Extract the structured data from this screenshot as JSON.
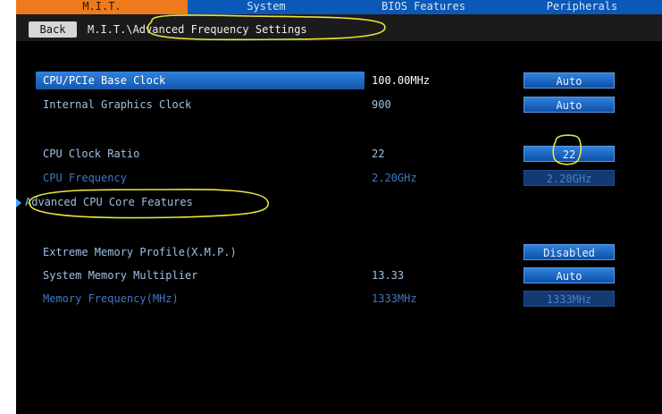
{
  "tabs": [
    "M.I.T.",
    "System",
    "BIOS Features",
    "Peripherals"
  ],
  "active_tab": "M.I.T.",
  "breadcrumb": {
    "back_label": "Back",
    "path": "M.I.T.\\Advanced Frequency Settings"
  },
  "rows": [
    {
      "label": "CPU/PCIe Base Clock",
      "value": "100.00MHz",
      "option": "Auto",
      "selected": true
    },
    {
      "label": "Internal Graphics Clock",
      "value": "900",
      "option": "Auto"
    },
    {
      "label": "CPU Clock Ratio",
      "value": "22",
      "option": "22"
    },
    {
      "label": "CPU Frequency",
      "value": "2.20GHz",
      "option": "2.20GHz",
      "disabled": true
    },
    {
      "label": "Advanced CPU Core Features",
      "submenu": true
    },
    {
      "label": "Extreme Memory Profile(X.M.P.)",
      "value": "",
      "option": "Disabled"
    },
    {
      "label": "System Memory Multiplier",
      "value": "13.33",
      "option": "Auto"
    },
    {
      "label": "Memory Frequency(MHz)",
      "value": "1333MHz",
      "option": "1333MHz",
      "disabled": true
    }
  ],
  "colors": {
    "tab_bar": "#0a58b7",
    "active_tab": "#ef7a1c",
    "selected_row": "#2f82de",
    "annotation": "#e8e63a"
  }
}
